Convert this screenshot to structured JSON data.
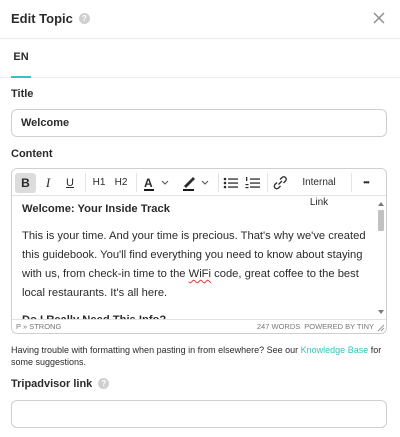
{
  "modal": {
    "title": "Edit Topic",
    "help_glyph": "?"
  },
  "tabs": [
    {
      "label": "EN",
      "active": true
    }
  ],
  "fields": {
    "title_label": "Title",
    "title_value": "Welcome",
    "content_label": "Content",
    "tripadvisor_label": "Tripadvisor link",
    "tripadvisor_value": ""
  },
  "toolbar": {
    "bold": "B",
    "italic": "I",
    "underline": "U",
    "h1": "H1",
    "h2": "H2",
    "text_color": "A",
    "internal_link": "Internal Link",
    "more": "•••"
  },
  "content": {
    "heading1": "Welcome: Your Inside Track",
    "paragraph1_before": "This is your time. And your time is precious. That's why we've created this guidebook. You'll find everything you need to know about staying with us, from check-in time to the ",
    "paragraph1_wifi": "WiFi",
    "paragraph1_after": " code, great coffee to the best local restaurants. It's all here.",
    "heading2": "Do I Really Need This Info?"
  },
  "statusbar": {
    "path": "P » STRONG",
    "word_count": "247 WORDS",
    "powered_by": "POWERED BY TINY"
  },
  "help": {
    "before": "Having trouble with formatting when pasting in from elsewhere? See our ",
    "link": "Knowledge Base",
    "after": " for some suggestions."
  },
  "colors": {
    "accent": "#36c3b8",
    "border": "#cfcfcf",
    "spellcheck": "#e03a3a"
  },
  "icons": [
    "help-icon",
    "close-icon",
    "text-color-icon",
    "highlight-icon",
    "chevron-down-icon",
    "bullet-list-icon",
    "numbered-list-icon",
    "link-icon",
    "resize-icon"
  ]
}
